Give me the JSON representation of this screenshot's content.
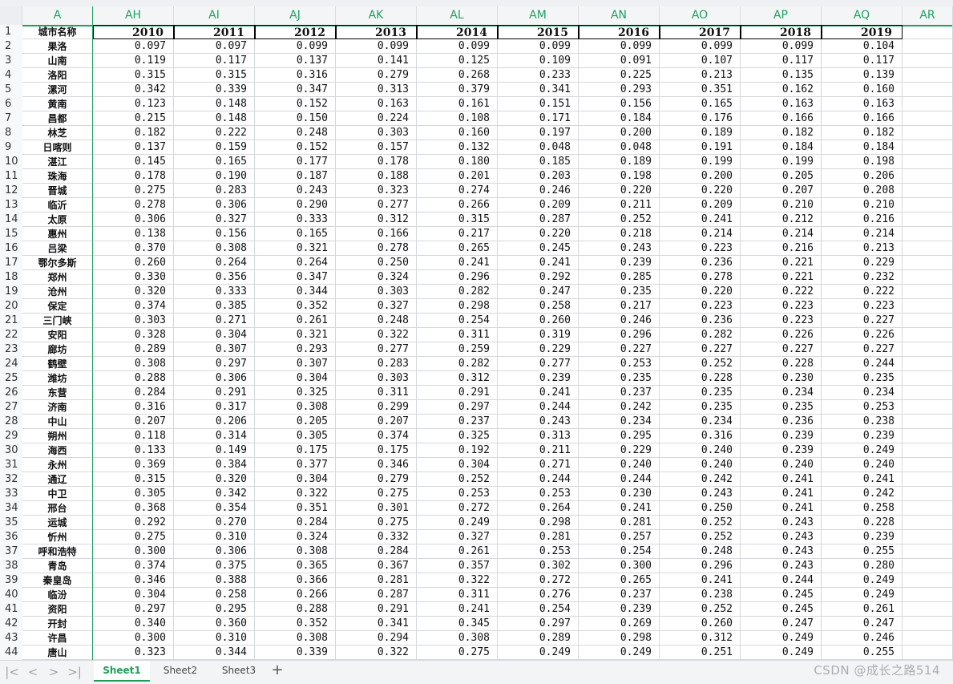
{
  "columns": [
    "A",
    "AH",
    "AI",
    "AJ",
    "AK",
    "AL",
    "AM",
    "AN",
    "AO",
    "AP",
    "AQ",
    "AR"
  ],
  "header_row": {
    "row_num": "1",
    "city_label": "城市名称",
    "years": [
      "2010",
      "2011",
      "2012",
      "2013",
      "2014",
      "2015",
      "2016",
      "2017",
      "2018",
      "2019"
    ]
  },
  "rows": [
    {
      "n": "2",
      "city": "果洛",
      "v": [
        "0.097",
        "0.097",
        "0.099",
        "0.099",
        "0.099",
        "0.099",
        "0.099",
        "0.099",
        "0.099",
        "0.104"
      ]
    },
    {
      "n": "3",
      "city": "山南",
      "v": [
        "0.119",
        "0.117",
        "0.137",
        "0.141",
        "0.125",
        "0.109",
        "0.091",
        "0.107",
        "0.117",
        "0.117"
      ]
    },
    {
      "n": "4",
      "city": "洛阳",
      "v": [
        "0.315",
        "0.315",
        "0.316",
        "0.279",
        "0.268",
        "0.233",
        "0.225",
        "0.213",
        "0.135",
        "0.139"
      ]
    },
    {
      "n": "5",
      "city": "漯河",
      "v": [
        "0.342",
        "0.339",
        "0.347",
        "0.313",
        "0.379",
        "0.341",
        "0.293",
        "0.351",
        "0.162",
        "0.160"
      ]
    },
    {
      "n": "6",
      "city": "黄南",
      "v": [
        "0.123",
        "0.148",
        "0.152",
        "0.163",
        "0.161",
        "0.151",
        "0.156",
        "0.165",
        "0.163",
        "0.163"
      ]
    },
    {
      "n": "7",
      "city": "昌都",
      "v": [
        "0.215",
        "0.148",
        "0.150",
        "0.224",
        "0.108",
        "0.171",
        "0.184",
        "0.176",
        "0.166",
        "0.166"
      ]
    },
    {
      "n": "8",
      "city": "林芝",
      "v": [
        "0.182",
        "0.222",
        "0.248",
        "0.303",
        "0.160",
        "0.197",
        "0.200",
        "0.189",
        "0.182",
        "0.182"
      ]
    },
    {
      "n": "9",
      "city": "日喀则",
      "v": [
        "0.137",
        "0.159",
        "0.152",
        "0.157",
        "0.132",
        "0.048",
        "0.048",
        "0.191",
        "0.184",
        "0.184"
      ]
    },
    {
      "n": "10",
      "city": "湛江",
      "v": [
        "0.145",
        "0.165",
        "0.177",
        "0.178",
        "0.180",
        "0.185",
        "0.189",
        "0.199",
        "0.199",
        "0.198"
      ]
    },
    {
      "n": "11",
      "city": "珠海",
      "v": [
        "0.178",
        "0.190",
        "0.187",
        "0.188",
        "0.201",
        "0.203",
        "0.198",
        "0.200",
        "0.205",
        "0.206"
      ]
    },
    {
      "n": "12",
      "city": "晋城",
      "v": [
        "0.275",
        "0.283",
        "0.243",
        "0.323",
        "0.274",
        "0.246",
        "0.220",
        "0.220",
        "0.207",
        "0.208"
      ]
    },
    {
      "n": "13",
      "city": "临沂",
      "v": [
        "0.278",
        "0.306",
        "0.290",
        "0.277",
        "0.266",
        "0.209",
        "0.211",
        "0.209",
        "0.210",
        "0.210"
      ]
    },
    {
      "n": "14",
      "city": "太原",
      "v": [
        "0.306",
        "0.327",
        "0.333",
        "0.312",
        "0.315",
        "0.287",
        "0.252",
        "0.241",
        "0.212",
        "0.216"
      ]
    },
    {
      "n": "15",
      "city": "惠州",
      "v": [
        "0.138",
        "0.156",
        "0.165",
        "0.166",
        "0.217",
        "0.220",
        "0.218",
        "0.214",
        "0.214",
        "0.214"
      ]
    },
    {
      "n": "16",
      "city": "吕梁",
      "v": [
        "0.370",
        "0.308",
        "0.321",
        "0.278",
        "0.265",
        "0.245",
        "0.243",
        "0.223",
        "0.216",
        "0.213"
      ]
    },
    {
      "n": "17",
      "city": "鄂尔多斯",
      "v": [
        "0.260",
        "0.264",
        "0.264",
        "0.250",
        "0.241",
        "0.241",
        "0.239",
        "0.236",
        "0.221",
        "0.229"
      ]
    },
    {
      "n": "18",
      "city": "郑州",
      "v": [
        "0.330",
        "0.356",
        "0.347",
        "0.324",
        "0.296",
        "0.292",
        "0.285",
        "0.278",
        "0.221",
        "0.232"
      ]
    },
    {
      "n": "19",
      "city": "沧州",
      "v": [
        "0.320",
        "0.333",
        "0.344",
        "0.303",
        "0.282",
        "0.247",
        "0.235",
        "0.220",
        "0.222",
        "0.222"
      ]
    },
    {
      "n": "20",
      "city": "保定",
      "v": [
        "0.374",
        "0.385",
        "0.352",
        "0.327",
        "0.298",
        "0.258",
        "0.217",
        "0.223",
        "0.223",
        "0.223"
      ]
    },
    {
      "n": "21",
      "city": "三门峡",
      "v": [
        "0.303",
        "0.271",
        "0.261",
        "0.248",
        "0.254",
        "0.260",
        "0.246",
        "0.236",
        "0.223",
        "0.227"
      ]
    },
    {
      "n": "22",
      "city": "安阳",
      "v": [
        "0.328",
        "0.304",
        "0.321",
        "0.322",
        "0.311",
        "0.319",
        "0.296",
        "0.282",
        "0.226",
        "0.226"
      ]
    },
    {
      "n": "23",
      "city": "廊坊",
      "v": [
        "0.289",
        "0.307",
        "0.293",
        "0.277",
        "0.259",
        "0.229",
        "0.227",
        "0.227",
        "0.227",
        "0.227"
      ]
    },
    {
      "n": "24",
      "city": "鹤壁",
      "v": [
        "0.308",
        "0.297",
        "0.307",
        "0.283",
        "0.282",
        "0.277",
        "0.253",
        "0.252",
        "0.228",
        "0.244"
      ]
    },
    {
      "n": "25",
      "city": "潍坊",
      "v": [
        "0.288",
        "0.306",
        "0.304",
        "0.303",
        "0.312",
        "0.239",
        "0.235",
        "0.228",
        "0.230",
        "0.235"
      ]
    },
    {
      "n": "26",
      "city": "东营",
      "v": [
        "0.284",
        "0.291",
        "0.325",
        "0.311",
        "0.291",
        "0.241",
        "0.237",
        "0.235",
        "0.234",
        "0.234"
      ]
    },
    {
      "n": "27",
      "city": "济南",
      "v": [
        "0.316",
        "0.317",
        "0.308",
        "0.299",
        "0.297",
        "0.244",
        "0.242",
        "0.235",
        "0.235",
        "0.253"
      ]
    },
    {
      "n": "28",
      "city": "中山",
      "v": [
        "0.207",
        "0.206",
        "0.205",
        "0.207",
        "0.237",
        "0.243",
        "0.234",
        "0.234",
        "0.236",
        "0.238"
      ]
    },
    {
      "n": "29",
      "city": "朔州",
      "v": [
        "0.118",
        "0.314",
        "0.305",
        "0.374",
        "0.325",
        "0.313",
        "0.295",
        "0.316",
        "0.239",
        "0.239"
      ]
    },
    {
      "n": "30",
      "city": "海西",
      "v": [
        "0.133",
        "0.149",
        "0.175",
        "0.175",
        "0.192",
        "0.211",
        "0.229",
        "0.240",
        "0.239",
        "0.249"
      ]
    },
    {
      "n": "31",
      "city": "永州",
      "v": [
        "0.369",
        "0.384",
        "0.377",
        "0.346",
        "0.304",
        "0.271",
        "0.240",
        "0.240",
        "0.240",
        "0.240"
      ]
    },
    {
      "n": "32",
      "city": "通辽",
      "v": [
        "0.315",
        "0.320",
        "0.304",
        "0.279",
        "0.252",
        "0.244",
        "0.244",
        "0.242",
        "0.241",
        "0.241"
      ]
    },
    {
      "n": "33",
      "city": "中卫",
      "v": [
        "0.305",
        "0.342",
        "0.322",
        "0.275",
        "0.253",
        "0.253",
        "0.230",
        "0.243",
        "0.241",
        "0.242"
      ]
    },
    {
      "n": "34",
      "city": "邢台",
      "v": [
        "0.368",
        "0.354",
        "0.351",
        "0.301",
        "0.272",
        "0.264",
        "0.241",
        "0.250",
        "0.241",
        "0.258"
      ]
    },
    {
      "n": "35",
      "city": "运城",
      "v": [
        "0.292",
        "0.270",
        "0.284",
        "0.275",
        "0.249",
        "0.298",
        "0.281",
        "0.252",
        "0.243",
        "0.228"
      ]
    },
    {
      "n": "36",
      "city": "忻州",
      "v": [
        "0.275",
        "0.310",
        "0.324",
        "0.332",
        "0.327",
        "0.281",
        "0.257",
        "0.252",
        "0.243",
        "0.239"
      ]
    },
    {
      "n": "37",
      "city": "呼和浩特",
      "v": [
        "0.300",
        "0.306",
        "0.308",
        "0.284",
        "0.261",
        "0.253",
        "0.254",
        "0.248",
        "0.243",
        "0.255"
      ]
    },
    {
      "n": "38",
      "city": "青岛",
      "v": [
        "0.374",
        "0.375",
        "0.365",
        "0.367",
        "0.357",
        "0.302",
        "0.300",
        "0.296",
        "0.243",
        "0.280"
      ]
    },
    {
      "n": "39",
      "city": "秦皇岛",
      "v": [
        "0.346",
        "0.388",
        "0.366",
        "0.281",
        "0.322",
        "0.272",
        "0.265",
        "0.241",
        "0.244",
        "0.249"
      ]
    },
    {
      "n": "40",
      "city": "临汾",
      "v": [
        "0.304",
        "0.258",
        "0.266",
        "0.287",
        "0.311",
        "0.276",
        "0.237",
        "0.238",
        "0.245",
        "0.249"
      ]
    },
    {
      "n": "41",
      "city": "资阳",
      "v": [
        "0.297",
        "0.295",
        "0.288",
        "0.291",
        "0.241",
        "0.254",
        "0.239",
        "0.252",
        "0.245",
        "0.261"
      ]
    },
    {
      "n": "42",
      "city": "开封",
      "v": [
        "0.340",
        "0.360",
        "0.352",
        "0.341",
        "0.345",
        "0.297",
        "0.269",
        "0.260",
        "0.247",
        "0.247"
      ]
    },
    {
      "n": "43",
      "city": "许昌",
      "v": [
        "0.300",
        "0.310",
        "0.308",
        "0.294",
        "0.308",
        "0.289",
        "0.298",
        "0.312",
        "0.249",
        "0.246"
      ]
    },
    {
      "n": "44",
      "city": "唐山",
      "v": [
        "0.323",
        "0.344",
        "0.339",
        "0.322",
        "0.275",
        "0.249",
        "0.249",
        "0.251",
        "0.249",
        "0.255"
      ]
    }
  ],
  "tabs": {
    "nav": [
      "|<",
      "<",
      ">",
      ">|"
    ],
    "sheets": [
      "Sheet1",
      "Sheet2",
      "Sheet3"
    ],
    "add": "+"
  },
  "watermark": "CSDN @成长之路514",
  "colors": {
    "accent": "#20a162"
  }
}
